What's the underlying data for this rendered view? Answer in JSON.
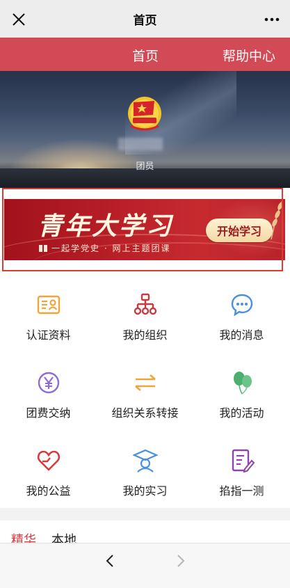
{
  "window": {
    "title": "首页",
    "close_icon": "close-icon",
    "more_icon": "more-dots-icon"
  },
  "tabs": {
    "home": "首页",
    "help": "帮助中心"
  },
  "profile": {
    "role": "团员",
    "badge_icon": "youth-league-badge-icon"
  },
  "banner": {
    "headline": "青年大学习",
    "subline": "一起学党史 · 网上主题团课",
    "button": "开始学习",
    "highlight_color": "#e03a35"
  },
  "menu": [
    {
      "label": "认证资料",
      "icon": "id-card-icon",
      "color": "#f0a53b"
    },
    {
      "label": "我的组织",
      "icon": "org-chart-icon",
      "color": "#c93a3e"
    },
    {
      "label": "我的消息",
      "icon": "message-bubble-icon",
      "color": "#4a90e2"
    },
    {
      "label": "团费交纳",
      "icon": "yuan-coin-icon",
      "color": "#8e6bd6"
    },
    {
      "label": "组织关系转接",
      "icon": "transfer-arrows-icon",
      "color": "#f0a53b"
    },
    {
      "label": "我的活动",
      "icon": "balloons-icon",
      "color": "#4caf6e"
    },
    {
      "label": "我的公益",
      "icon": "heart-hand-icon",
      "color": "#d63a3a"
    },
    {
      "label": "我的实习",
      "icon": "graduate-cap-icon",
      "color": "#4a90e2"
    },
    {
      "label": "掐指一测",
      "icon": "quiz-pencil-icon",
      "color": "#8e44ad"
    }
  ],
  "content_tabs": {
    "active": "精华",
    "other": "本地"
  },
  "footer": {
    "back_icon": "chevron-left-icon",
    "forward_icon": "chevron-right-icon"
  },
  "colors": {
    "header_red": "#d24a56",
    "accent_red": "#d83a3f"
  }
}
